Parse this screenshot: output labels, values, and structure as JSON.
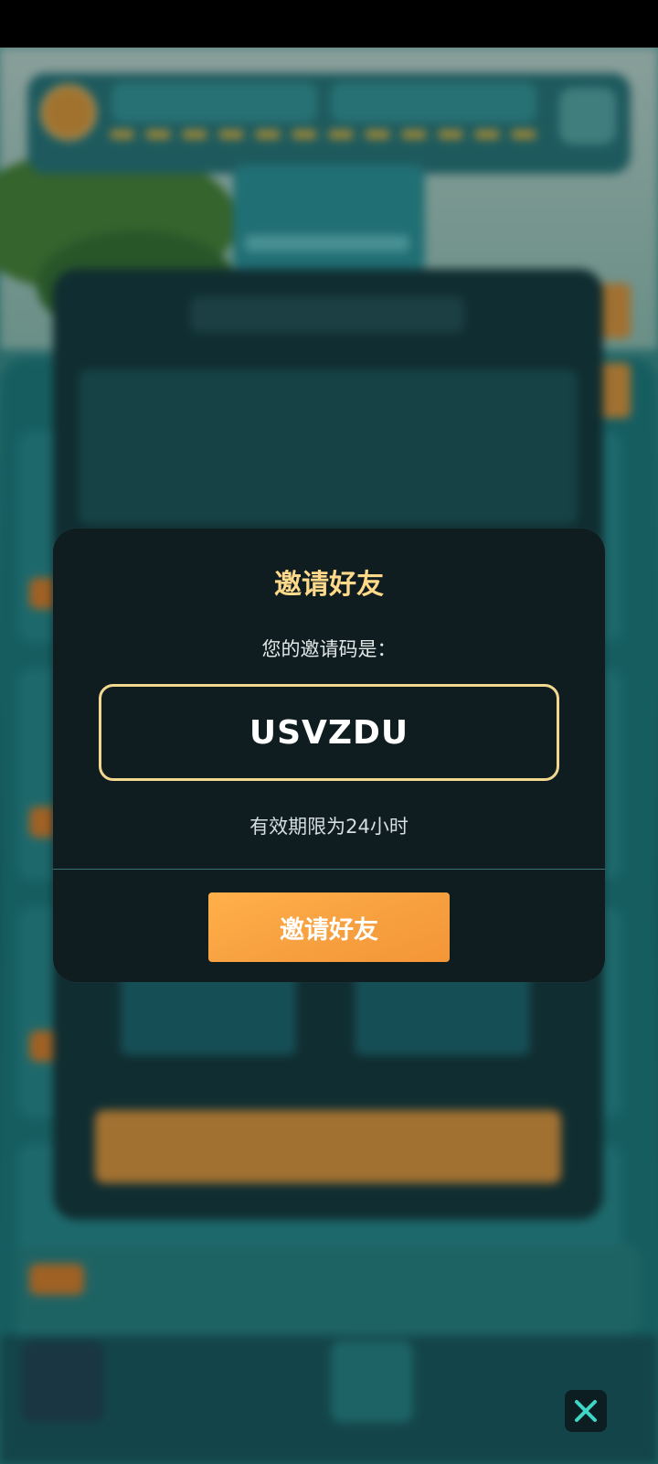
{
  "dialog": {
    "title": "邀请好友",
    "subtitle": "您的邀请码是：",
    "invite_code": "USVZDU",
    "validity": "有效期限为24小时",
    "button_label": "邀请好友"
  },
  "icons": {
    "close": "close-icon"
  },
  "colors": {
    "dialog_bg": "#0f1d20",
    "title_color": "#ffd98a",
    "code_border": "#f2d88f",
    "button_color": "#f7a040",
    "close_icon_color": "#3fd6c6"
  }
}
